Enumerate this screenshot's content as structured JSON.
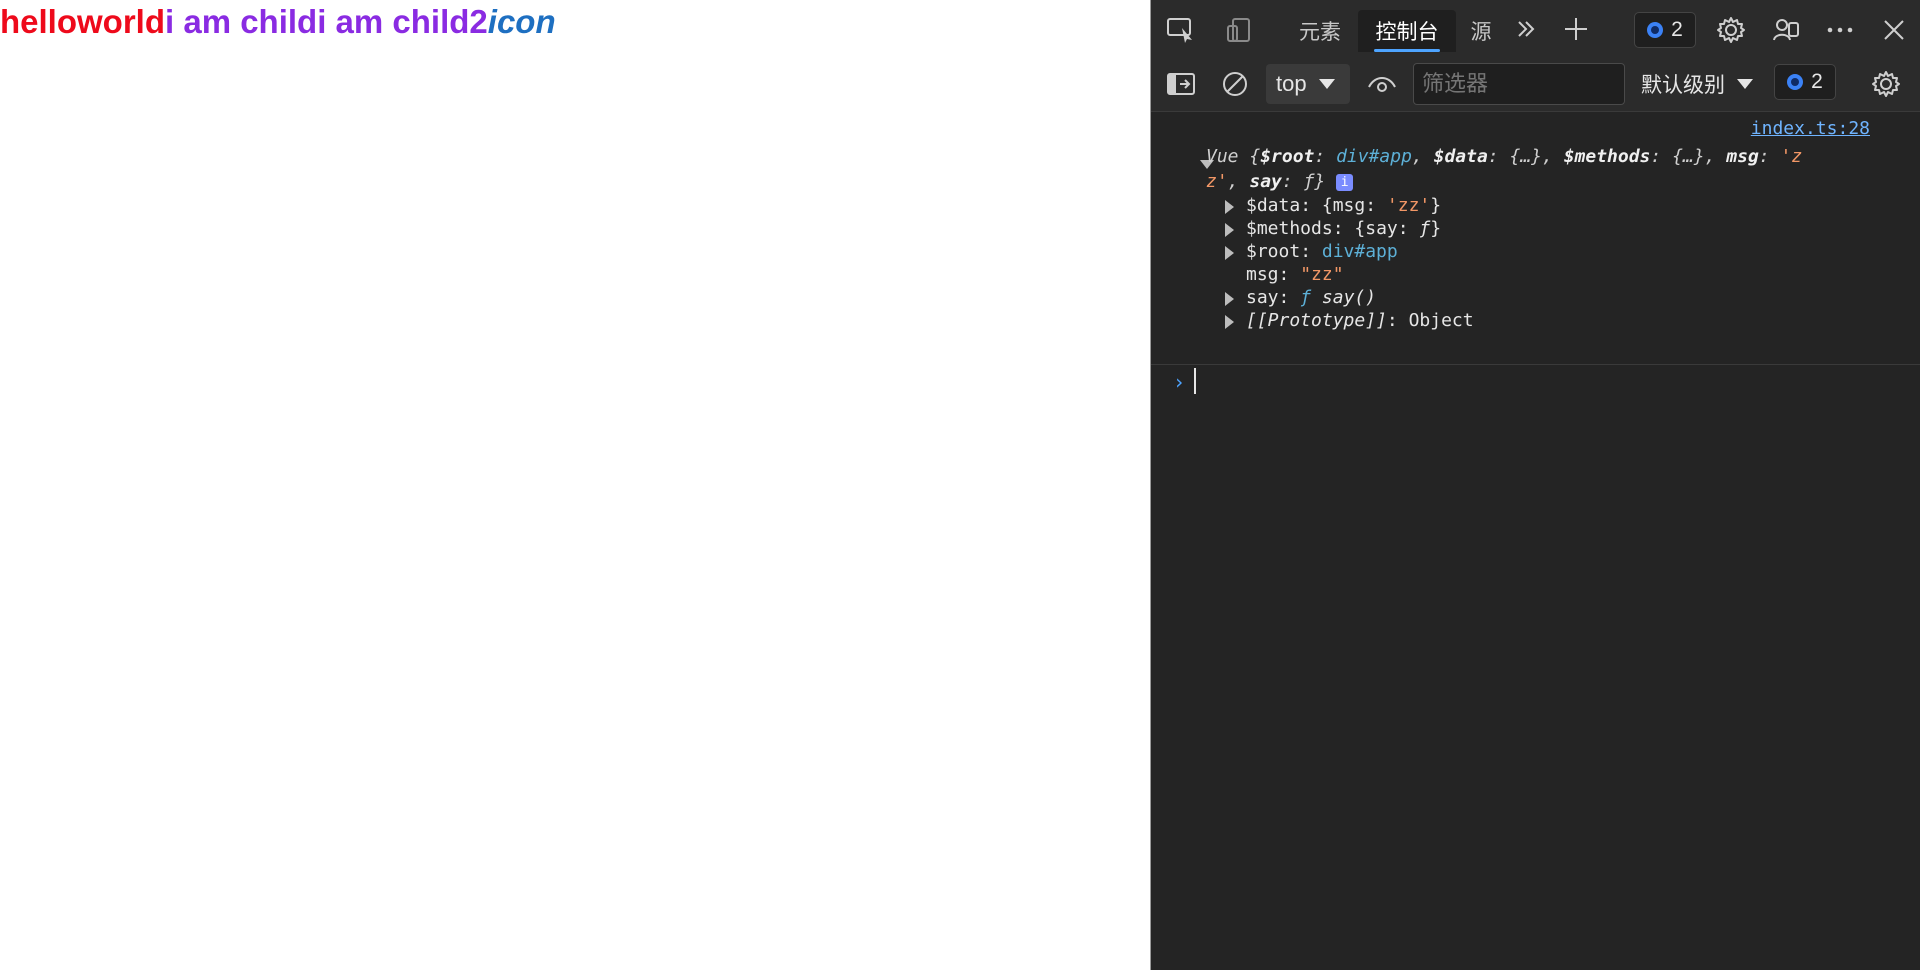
{
  "page": {
    "text_1": "helloworld",
    "text_2": "i am child",
    "text_3": "i am child2",
    "text_4": "icon"
  },
  "devtools": {
    "tabs": [
      "元素",
      "控制台",
      "源"
    ],
    "active_tab": "控制台",
    "issues_badge_count": "2",
    "context_select": "top",
    "filter_placeholder": "筛选器",
    "log_level": "默认级别",
    "messages_badge_count": "2"
  },
  "console": {
    "source_link": "index.ts:28",
    "object_header": {
      "prefix": "Vue {",
      "root_key": "$root",
      "root_val": "div#app",
      "data_key": "$data",
      "data_val": "{…}",
      "methods_key": "$methods",
      "methods_val": "{…}",
      "msg_key": "msg",
      "msg_val_a": "'z",
      "msg_val_b": "z'",
      "say_key": "say",
      "say_val": "ƒ",
      "suffix": "}"
    },
    "properties": [
      {
        "key": "$data",
        "value": "{msg: ",
        "value_str": "'zz'",
        "value_end": "}"
      },
      {
        "key": "$methods",
        "value": "{say: ",
        "value_fn": "ƒ",
        "value_end": "}"
      },
      {
        "key": "$root",
        "value_tag": "div#app"
      },
      {
        "key": "msg",
        "value_str": "\"zz\""
      },
      {
        "key": "say",
        "value_fn": "ƒ",
        "value_call": "say()"
      },
      {
        "key": "[[Prototype]]",
        "value": "Object"
      }
    ]
  },
  "colors": {
    "red": "#ee0a1b",
    "purple": "#8a2be2",
    "blue": "#1e6fc1",
    "devtools_bg": "#242424",
    "accent": "#4ea4ff"
  }
}
